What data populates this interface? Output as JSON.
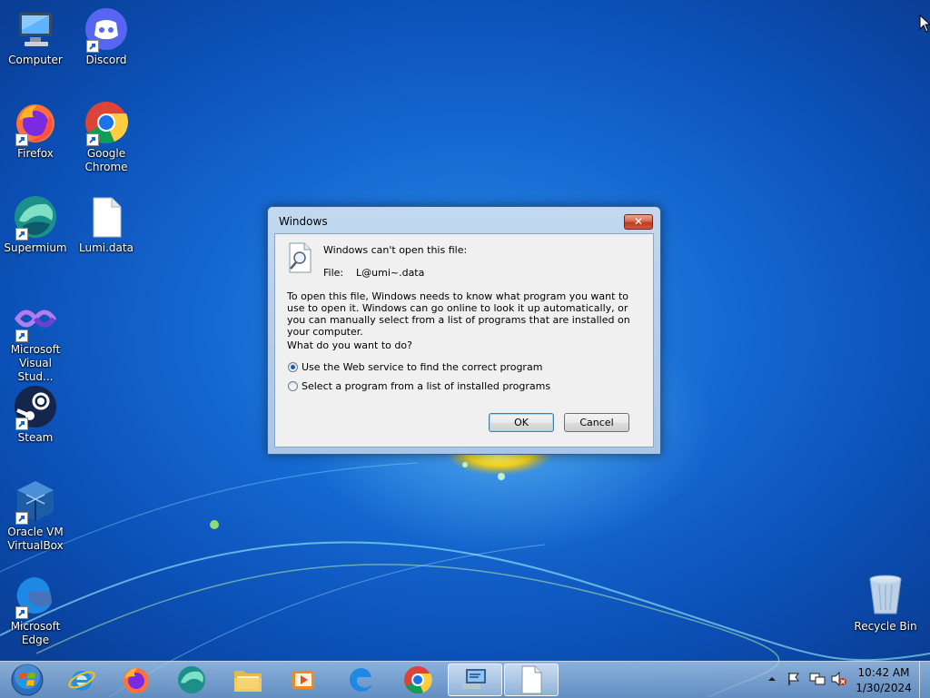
{
  "desktop": {
    "icons": [
      {
        "label": "Computer",
        "icon": "computer-icon"
      },
      {
        "label": "Discord",
        "icon": "discord-icon"
      },
      {
        "label": "Firefox",
        "icon": "firefox-icon"
      },
      {
        "label": "Google\nChrome",
        "icon": "chrome-icon"
      },
      {
        "label": "Supermium",
        "icon": "supermium-icon"
      },
      {
        "label": "Lumi.data",
        "icon": "file-icon"
      },
      {
        "label": "Microsoft\nVisual Stud...",
        "icon": "visual-studio-icon"
      },
      {
        "label": "Steam",
        "icon": "steam-icon"
      },
      {
        "label": "Oracle VM\nVirtualBox",
        "icon": "virtualbox-icon"
      },
      {
        "label": "Microsoft\nEdge",
        "icon": "edge-icon"
      },
      {
        "label": "Recycle Bin",
        "icon": "recycle-bin-icon"
      }
    ]
  },
  "dialog": {
    "title": "Windows",
    "close_label": "✕",
    "heading": "Windows can't open this file:",
    "file_label": "File:",
    "file_name": "L@umi~.data",
    "description": "To open this file, Windows needs to know what program you want to use to open it. Windows can go online to look it up automatically, or you can manually select from a list of programs that are installed on your computer.",
    "question": "What do you want to do?",
    "options": [
      {
        "label": "Use the Web service to find the correct program",
        "selected": true
      },
      {
        "label": "Select a program from a list of installed programs",
        "selected": false
      }
    ],
    "ok_label": "OK",
    "cancel_label": "Cancel"
  },
  "taskbar": {
    "items": [
      "start-button",
      "internet-explorer-icon",
      "firefox-icon",
      "supermium-icon",
      "file-explorer-icon",
      "media-player-icon",
      "edge-icon",
      "chrome-icon",
      "network-window-icon",
      "blank-document-icon"
    ],
    "clock_time": "10:42 AM",
    "clock_date": "1/30/2024"
  }
}
